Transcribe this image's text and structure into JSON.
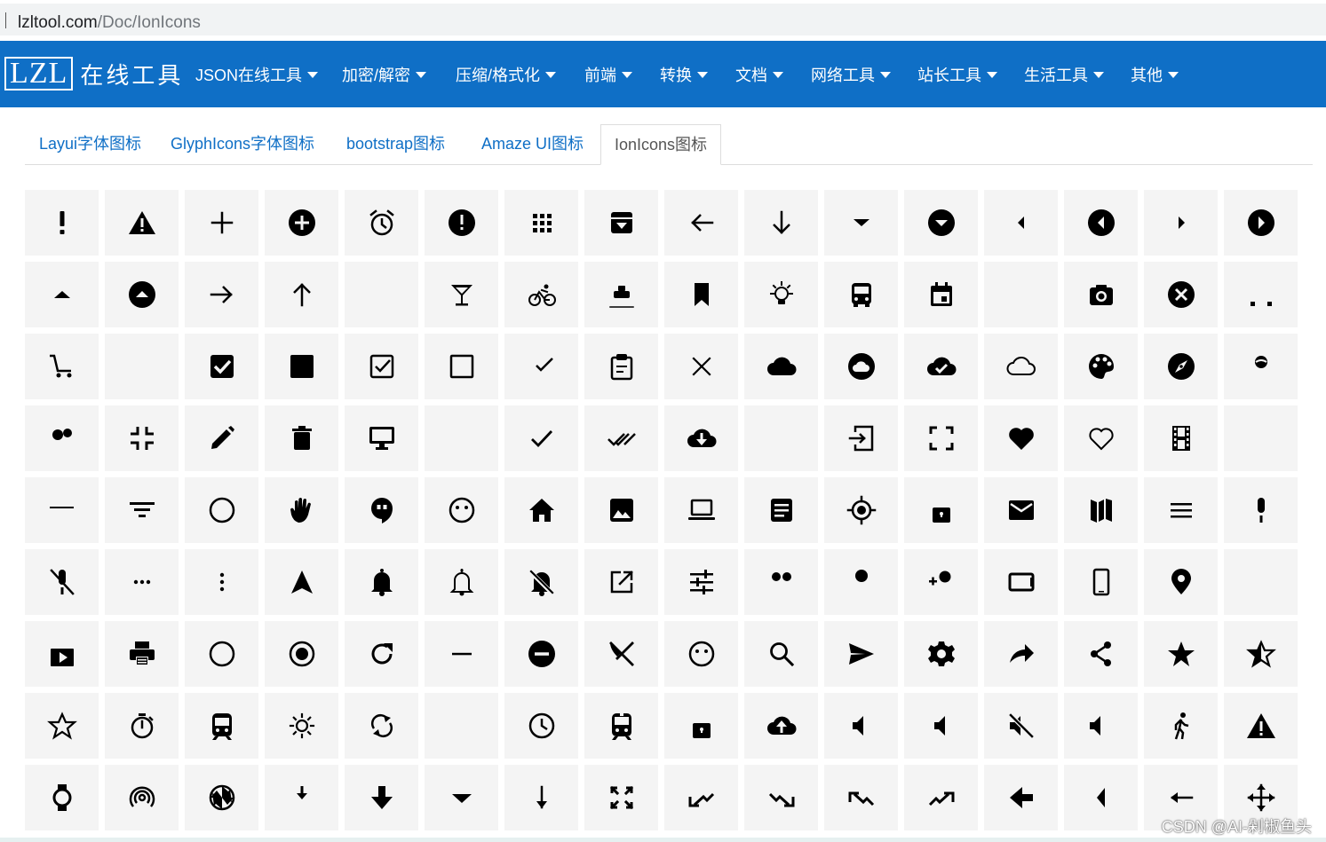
{
  "browser": {
    "host": "lzltool.com",
    "path": "/Doc/IonIcons"
  },
  "logo": {
    "mark": "LZL",
    "name": "在线工具"
  },
  "menu": [
    {
      "label": "JSON在线工具"
    },
    {
      "label": "加密/解密"
    },
    {
      "label": "压缩/格式化"
    },
    {
      "label": "前端"
    },
    {
      "label": "转换"
    },
    {
      "label": "文档"
    },
    {
      "label": "网络工具"
    },
    {
      "label": "站长工具"
    },
    {
      "label": "生活工具"
    },
    {
      "label": "其他"
    }
  ],
  "tabs": [
    {
      "label": "Layui字体图标"
    },
    {
      "label": "GlyphIcons字体图标"
    },
    {
      "label": "bootstrap图标"
    },
    {
      "label": "Amaze UI图标"
    },
    {
      "label": "IonIcons图标",
      "active": true
    }
  ],
  "colors": {
    "brand": "#0f6fc6",
    "tile": "#f4f4f4",
    "icon": "#000000"
  },
  "icons": [
    [
      "alert-icon",
      "alert-triangle-icon",
      "add-icon",
      "add-circle-icon",
      "alarm-icon",
      "alert-circle-icon",
      "apps-icon",
      "archive-icon",
      "arrow-back-icon",
      "arrow-down-icon",
      "caret-down-icon",
      "caret-down-circle-icon",
      "caret-left-icon",
      "caret-left-circle-icon",
      "caret-right-icon",
      "caret-right-circle-icon"
    ],
    [
      "caret-up-icon",
      "caret-up-circle-icon",
      "arrow-forward-icon",
      "arrow-up-icon",
      "attach-icon",
      "cocktail-icon",
      "bicycle-icon",
      "boat-icon",
      "bookmark-icon",
      "bulb-icon",
      "bus-icon",
      "calendar-icon",
      "call-icon",
      "camera-icon",
      "close-circle-icon",
      "car-icon"
    ],
    [
      "cart-icon",
      "chatboxes-icon",
      "checkbox-checked-icon",
      "square-filled-icon",
      "checkbox-outline-icon",
      "square-outline-icon",
      "checkmark-circle-outline-icon",
      "clipboard-icon",
      "close-icon",
      "cloud-icon",
      "cloud-circle-icon",
      "cloud-done-icon",
      "cloud-outline-icon",
      "color-palette-icon",
      "compass-icon",
      "contact-icon"
    ],
    [
      "contacts-icon",
      "contract-icon",
      "create-icon",
      "trash-icon",
      "desktop-icon",
      "document-icon",
      "checkmark-icon",
      "done-all-icon",
      "download-cloud-icon",
      "open-mail-icon",
      "exit-icon",
      "expand-icon",
      "heart-icon",
      "heart-outline-icon",
      "film-icon",
      "folder-icon"
    ],
    [
      "folder-open-icon",
      "funnel-icon",
      "globe-icon",
      "hand-icon",
      "hangout-icon",
      "happy-icon",
      "home-icon",
      "image-icon",
      "laptop-icon",
      "list-box-icon",
      "locate-icon",
      "lock-icon",
      "mail-icon",
      "map-icon",
      "menu-icon",
      "mic-icon"
    ],
    [
      "mic-off-icon",
      "more-icon",
      "more-vertical-icon",
      "navigate-icon",
      "notifications-icon",
      "notifications-outline-icon",
      "notifications-off-icon",
      "open-icon",
      "options-icon",
      "people-icon",
      "person-icon",
      "person-add-icon",
      "tablet-landscape-icon",
      "phone-portrait-icon",
      "pin-icon",
      "plane-icon"
    ],
    [
      "play-store-icon",
      "print-icon",
      "radio-button-off-icon",
      "radio-button-on-icon",
      "refresh-icon",
      "remove-icon",
      "remove-circle-icon",
      "restaurant-icon",
      "sad-icon",
      "search-icon",
      "send-icon",
      "settings-icon",
      "share-alt-icon",
      "share-icon",
      "star-icon",
      "star-half-icon"
    ],
    [
      "star-outline-icon",
      "stopwatch-icon",
      "subway-icon",
      "sunny-icon",
      "sync-icon",
      "text-icon",
      "time-icon",
      "train-icon",
      "unlock-icon",
      "upload-cloud-icon",
      "volume-down-icon",
      "volume-mute-icon",
      "volume-off-icon",
      "volume-up-icon",
      "walk-icon",
      "warning-icon"
    ],
    [
      "watch-icon",
      "wifi-icon",
      "aperture-icon",
      "download-icon",
      "arrow-down-bold-icon",
      "arrow-dropdown-icon",
      "arrow-down-thin-icon",
      "expand-arrows-icon",
      "trending-down-left-icon",
      "trending-down-icon",
      "trending-up-left-icon",
      "trending-up-icon",
      "arrow-left-bold-icon",
      "arrow-dropleft-icon",
      "arrow-left-thin-icon",
      "move-icon"
    ]
  ],
  "watermark": "CSDN @AI-剁椒鱼头"
}
